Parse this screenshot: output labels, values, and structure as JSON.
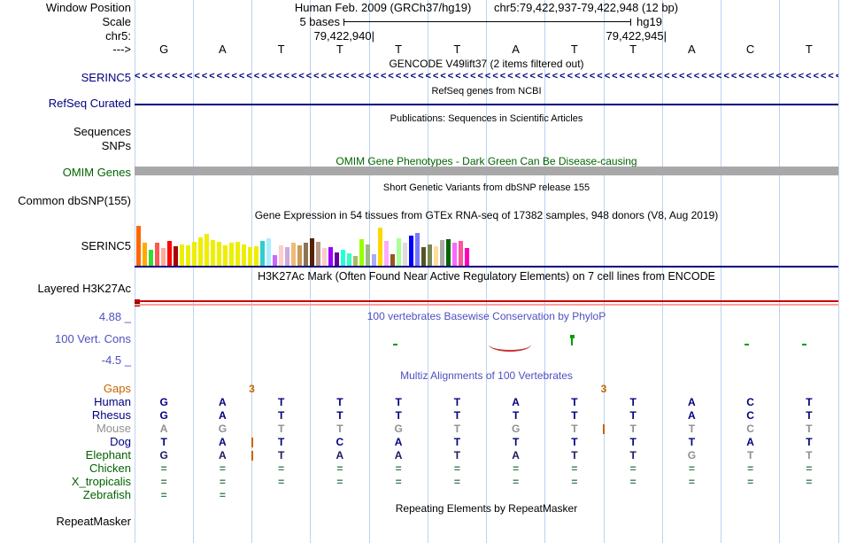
{
  "colors": {
    "navy": "#000080",
    "green": "#006400",
    "blue": "#4f4fc0",
    "orange": "#c86400",
    "guide": "#bcd2f2",
    "omim_gray": "#a8a8a8",
    "h3k27ac_red": "#cc0000",
    "h3k27ac_pink": "#ff9e9e",
    "h3k27ac_dark": "#8b0000",
    "phylop_green": "#00a000",
    "phylop_red": "#c83232"
  },
  "header": {
    "assembly": "Human Feb. 2009 (GRCh37/hg19)",
    "position": "chr5:79,422,937-79,422,948 (12 bp)"
  },
  "gutter": {
    "window_position": "Window Position",
    "scale": "Scale",
    "chrom": "chr5:",
    "direction": "--->"
  },
  "ruler": {
    "scale_label": "5 bases",
    "genome": "hg19",
    "coord1": "79,422,940|",
    "coord2": "79,422,945|",
    "bases": [
      "G",
      "A",
      "T",
      "T",
      "T",
      "T",
      "A",
      "T",
      "T",
      "A",
      "C",
      "T"
    ]
  },
  "tracks": {
    "gencode": {
      "header": "GENCODE V49lift37 (2 items filtered out)",
      "label": "SERINC5",
      "strand_glyph": "<"
    },
    "refseq": {
      "header": "RefSeq genes from NCBI",
      "label": "RefSeq Curated"
    },
    "publications": {
      "header": "Publications: Sequences in Scientific Articles",
      "label_sequences": "Sequences",
      "label_snps": "SNPs"
    },
    "omim": {
      "header": "OMIM Gene Phenotypes - Dark Green Can Be Disease-causing",
      "label": "OMIM Genes"
    },
    "dbsnp": {
      "header": "Short Genetic Variants from dbSNP release 155",
      "label": "Common dbSNP(155)"
    },
    "gtex": {
      "header": "Gene Expression in 54 tissues from GTEx RNA-seq of 17382 samples, 948 donors (V8, Aug 2019)",
      "label": "SERINC5",
      "bars": [
        [
          45,
          "#FF6600"
        ],
        [
          26,
          "#FFAA00"
        ],
        [
          18,
          "#33DD33"
        ],
        [
          26,
          "#FF5555"
        ],
        [
          20,
          "#FFAA99"
        ],
        [
          28,
          "#FF0000"
        ],
        [
          22,
          "#AA0000"
        ],
        [
          24,
          "#EEEE00"
        ],
        [
          23,
          "#EEEE00"
        ],
        [
          27,
          "#EEEE00"
        ],
        [
          32,
          "#EEEE00"
        ],
        [
          36,
          "#EEEE00"
        ],
        [
          29,
          "#EEEE00"
        ],
        [
          27,
          "#EEEE00"
        ],
        [
          23,
          "#EEEE00"
        ],
        [
          26,
          "#EEEE00"
        ],
        [
          27,
          "#EEEE00"
        ],
        [
          24,
          "#EEEE00"
        ],
        [
          21,
          "#EEEE00"
        ],
        [
          22,
          "#EEEE00"
        ],
        [
          28,
          "#33CCCC"
        ],
        [
          31,
          "#AAEEFF"
        ],
        [
          12,
          "#CC66FF"
        ],
        [
          23,
          "#FFCCCC"
        ],
        [
          21,
          "#CCAADD"
        ],
        [
          26,
          "#EEBB77"
        ],
        [
          23,
          "#CC9955"
        ],
        [
          26,
          "#8B7355"
        ],
        [
          31,
          "#552200"
        ],
        [
          27,
          "#BB9988"
        ],
        [
          20,
          "#FFCCCC"
        ],
        [
          21,
          "#9900FF"
        ],
        [
          15,
          "#660099"
        ],
        [
          18,
          "#22FFDD"
        ],
        [
          14,
          "#33FFC2"
        ],
        [
          11,
          "#AABB66"
        ],
        [
          30,
          "#99FF00"
        ],
        [
          24,
          "#99BB88"
        ],
        [
          13,
          "#AAAAFF"
        ],
        [
          43,
          "#FFD700"
        ],
        [
          28,
          "#FFAAFF"
        ],
        [
          13,
          "#995522"
        ],
        [
          31,
          "#AAFF99"
        ],
        [
          26,
          "#DDDDDD"
        ],
        [
          34,
          "#0000FF"
        ],
        [
          37,
          "#7777FF"
        ],
        [
          21,
          "#555522"
        ],
        [
          24,
          "#778855"
        ],
        [
          22,
          "#FFDD99"
        ],
        [
          29,
          "#AAAAAA"
        ],
        [
          30,
          "#006600"
        ],
        [
          26,
          "#FF66FF"
        ],
        [
          28,
          "#FF5599"
        ],
        [
          20,
          "#FF00BB"
        ]
      ]
    },
    "h3k27ac": {
      "header": "H3K27Ac Mark (Often Found Near Active Regulatory Elements) on 7 cell lines from ENCODE",
      "label": "Layered H3K27Ac"
    },
    "phylop": {
      "header": "100 vertebrates Basewise Conservation by PhyloP",
      "label": "100 Vert. Cons",
      "ymax": "4.88 _",
      "ymin": "-4.5 _",
      "marks": [
        {
          "kind": "dash",
          "x": 0.37,
          "color": "#00a000"
        },
        {
          "kind": "dip",
          "x": 0.533,
          "w": 48,
          "color": "#c83232"
        },
        {
          "kind": "lollipop",
          "x": 0.622,
          "h": 9,
          "color": "#00a000"
        },
        {
          "kind": "dash",
          "x": 0.87,
          "color": "#00a000"
        },
        {
          "kind": "dash",
          "x": 0.952,
          "color": "#00a000"
        }
      ]
    },
    "multiz": {
      "header": "Multiz Alignments of 100 Vertebrates",
      "rows": [
        {
          "label": "Gaps",
          "label_color": "#c86400",
          "cell_color": "#c86400",
          "cells": [
            "",
            "",
            "",
            "",
            "",
            "",
            "",
            "",
            "",
            "",
            "",
            ""
          ]
        },
        {
          "label": "Human",
          "label_color": "#000080",
          "cell_color": "#000080",
          "cells": [
            "G",
            "A",
            "T",
            "T",
            "T",
            "T",
            "A",
            "T",
            "T",
            "A",
            "C",
            "T"
          ]
        },
        {
          "label": "Rhesus",
          "label_color": "#000080",
          "cell_color": "#000080",
          "cells": [
            "G",
            "A",
            "T",
            "T",
            "T",
            "T",
            "T",
            "T",
            "T",
            "A",
            "C",
            "T"
          ]
        },
        {
          "label": "Mouse",
          "label_color": "#909090",
          "cell_color": "#909090",
          "cells": [
            "A",
            "G",
            "T",
            "T",
            "G",
            "T",
            "G",
            "T",
            "T",
            "T",
            "C",
            "T"
          ]
        },
        {
          "label": "Dog",
          "label_color": "#000080",
          "cell_color": "#000080",
          "cells": [
            "T",
            "A",
            "T",
            "C",
            "A",
            "T",
            "T",
            "T",
            "T",
            "T",
            "A",
            "T"
          ]
        },
        {
          "label": "Elephant",
          "label_color": "#006400",
          "cell_color": "#1a1a60",
          "cells": [
            "G",
            "A",
            "T",
            "A",
            "A",
            "T",
            "A",
            "T",
            "T",
            "G",
            "T",
            "T"
          ],
          "cell_colors": {
            "9": "#909090",
            "10": "#909090",
            "11": "#909090"
          }
        },
        {
          "label": "Chicken",
          "label_color": "#006400",
          "cell_color": "#3c8054",
          "cells": [
            "=",
            "=",
            "=",
            "=",
            "=",
            "=",
            "=",
            "=",
            "=",
            "=",
            "=",
            "="
          ]
        },
        {
          "label": "X_tropicalis",
          "label_color": "#006400",
          "cell_color": "#3c8054",
          "cells": [
            "=",
            "=",
            "=",
            "=",
            "=",
            "=",
            "=",
            "=",
            "=",
            "=",
            "=",
            "="
          ]
        },
        {
          "label": "Zebrafish",
          "label_color": "#006400",
          "cell_color": "#3c8054",
          "cells": [
            "=",
            "=",
            "",
            "",
            "",
            "",
            "",
            "",
            "",
            "",
            "",
            ""
          ]
        }
      ],
      "gaps": [
        {
          "boundary": 2,
          "size": "3"
        },
        {
          "boundary": 8,
          "size": "3"
        }
      ],
      "insert_ticks": [
        {
          "row": "Mouse",
          "boundary": 8
        },
        {
          "row": "Dog",
          "boundary": 2
        },
        {
          "row": "Elephant",
          "boundary": 2
        }
      ]
    },
    "repeatmasker": {
      "header": "Repeating Elements by RepeatMasker",
      "label": "RepeatMasker"
    }
  }
}
